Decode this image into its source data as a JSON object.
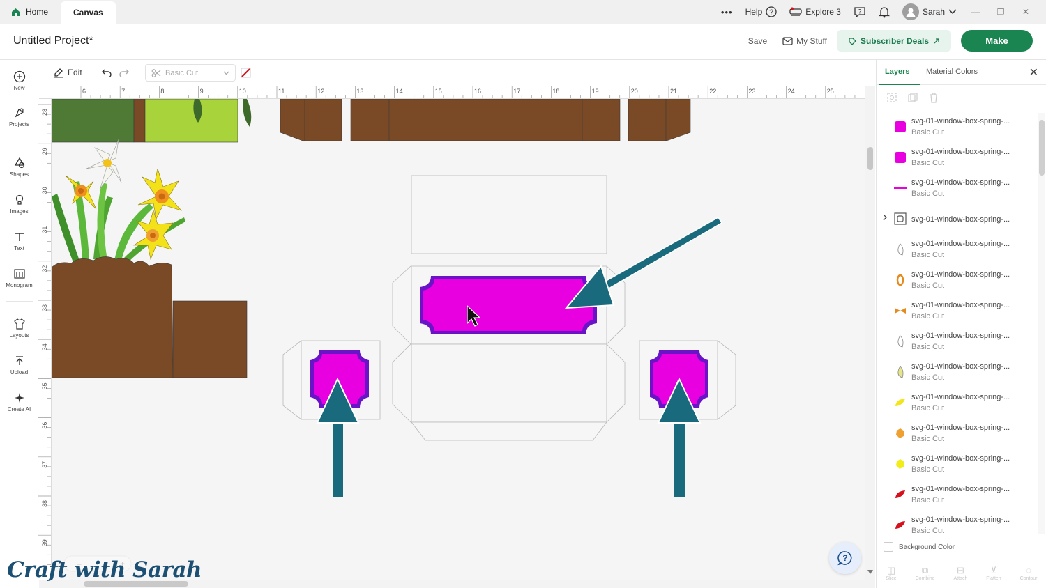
{
  "top_tabs": {
    "home": "Home",
    "canvas": "Canvas"
  },
  "top_right": {
    "more": "•••",
    "help": "Help",
    "explore": "Explore 3",
    "user": "Sarah"
  },
  "project": {
    "title": "Untitled Project*",
    "save": "Save",
    "my_stuff": "My Stuff",
    "subscriber_deals": "Subscriber Deals",
    "make": "Make"
  },
  "left_sidebar": [
    {
      "label": "New",
      "icon": "plus-circle-icon"
    },
    {
      "label": "Projects",
      "icon": "projects-icon"
    },
    {
      "label": "Shapes",
      "icon": "shapes-icon"
    },
    {
      "label": "Images",
      "icon": "bulb-icon"
    },
    {
      "label": "Text",
      "icon": "text-icon"
    },
    {
      "label": "Monogram",
      "icon": "monogram-icon"
    },
    {
      "label": "Layouts",
      "icon": "tshirt-icon"
    },
    {
      "label": "Upload",
      "icon": "upload-icon"
    },
    {
      "label": "Create AI",
      "icon": "sparkle-icon"
    }
  ],
  "toolbar": {
    "edit": "Edit",
    "operation": "Basic Cut"
  },
  "ruler_top": [
    "6",
    "7",
    "8",
    "9",
    "10",
    "11",
    "12",
    "13",
    "14",
    "15",
    "16",
    "17",
    "18",
    "19",
    "20",
    "21",
    "22",
    "23",
    "24",
    "25"
  ],
  "ruler_left": [
    "28",
    "29",
    "30",
    "31",
    "32",
    "33",
    "34",
    "35",
    "36",
    "37",
    "38",
    "39"
  ],
  "panel": {
    "tab_layers": "Layers",
    "tab_material": "Material Colors",
    "background_color": "Background Color",
    "footer": [
      "Slice",
      "Combine",
      "Attach",
      "Flatten",
      "Contour"
    ]
  },
  "layers": [
    {
      "name": "svg-01-window-box-spring-...",
      "type": "Basic Cut",
      "color": "#e800e0",
      "shape": "rounded-square"
    },
    {
      "name": "svg-01-window-box-spring-...",
      "type": "Basic Cut",
      "color": "#e800e0",
      "shape": "rounded-square"
    },
    {
      "name": "svg-01-window-box-spring-...",
      "type": "Basic Cut",
      "color": "#e800e0",
      "shape": "bar"
    },
    {
      "name": "svg-01-window-box-spring-...",
      "type": "",
      "color": "#555555",
      "shape": "group"
    },
    {
      "name": "svg-01-window-box-spring-...",
      "type": "Basic Cut",
      "color": "#ffffff",
      "shape": "petal"
    },
    {
      "name": "svg-01-window-box-spring-...",
      "type": "Basic Cut",
      "color": "#e58a1e",
      "shape": "ring"
    },
    {
      "name": "svg-01-window-box-spring-...",
      "type": "Basic Cut",
      "color": "#e58a1e",
      "shape": "bow"
    },
    {
      "name": "svg-01-window-box-spring-...",
      "type": "Basic Cut",
      "color": "#ffffff",
      "shape": "petal"
    },
    {
      "name": "svg-01-window-box-spring-...",
      "type": "Basic Cut",
      "color": "#e5e58a",
      "shape": "petal"
    },
    {
      "name": "svg-01-window-box-spring-...",
      "type": "Basic Cut",
      "color": "#f2e61a",
      "shape": "leaf"
    },
    {
      "name": "svg-01-window-box-spring-...",
      "type": "Basic Cut",
      "color": "#f0a030",
      "shape": "blob"
    },
    {
      "name": "svg-01-window-box-spring-...",
      "type": "Basic Cut",
      "color": "#f2ec1a",
      "shape": "blob"
    },
    {
      "name": "svg-01-window-box-spring-...",
      "type": "Basic Cut",
      "color": "#d6101c",
      "shape": "leaf"
    },
    {
      "name": "svg-01-window-box-spring-...",
      "type": "Basic Cut",
      "color": "#d6101c",
      "shape": "leaf"
    }
  ],
  "colors": {
    "accent_green": "#1b8551",
    "magenta": "#e800e0",
    "purple": "#6a14c8",
    "soil_brown": "#7a4a26",
    "arrow_teal": "#1a6a7e"
  },
  "watermark": "Craft with Sarah"
}
